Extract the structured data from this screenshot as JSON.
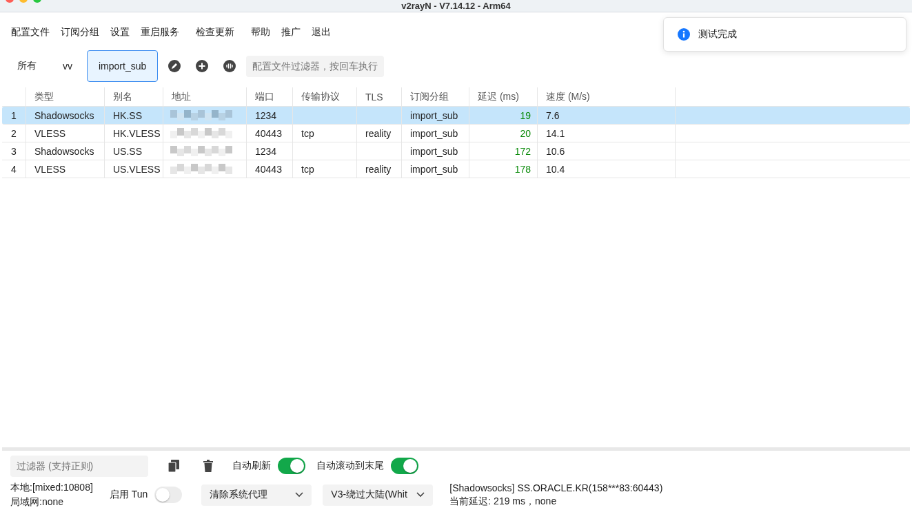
{
  "window": {
    "title": "v2rayN - V7.14.12 - Arm64"
  },
  "menu": [
    "配置文件",
    "订阅分组",
    "设置",
    "重启服务",
    "检查更新",
    "帮助",
    "推广",
    "退出"
  ],
  "tabs": [
    {
      "label": "所有",
      "selected": false
    },
    {
      "label": "vv",
      "selected": false
    },
    {
      "label": "import_sub",
      "selected": true
    }
  ],
  "profile_filter": {
    "placeholder": "配置文件过滤器，按回车执行"
  },
  "table": {
    "columns": [
      "类型",
      "别名",
      "地址",
      "端口",
      "传输协议",
      "TLS",
      "订阅分组",
      "延迟 (ms)",
      "速度 (M/s)"
    ],
    "rows": [
      {
        "index": "1",
        "type": "Shadowsocks",
        "alias": "HK.SS",
        "port": "1234",
        "transport": "",
        "tls": "",
        "group": "import_sub",
        "latency": "19",
        "speed": "7.6",
        "selected": true
      },
      {
        "index": "2",
        "type": "VLESS",
        "alias": "HK.VLESS",
        "port": "40443",
        "transport": "tcp",
        "tls": "reality",
        "group": "import_sub",
        "latency": "20",
        "speed": "14.1",
        "selected": false
      },
      {
        "index": "3",
        "type": "Shadowsocks",
        "alias": "US.SS",
        "port": "1234",
        "transport": "",
        "tls": "",
        "group": "import_sub",
        "latency": "172",
        "speed": "10.6",
        "selected": false
      },
      {
        "index": "4",
        "type": "VLESS",
        "alias": "US.VLESS",
        "port": "40443",
        "transport": "tcp",
        "tls": "reality",
        "group": "import_sub",
        "latency": "178",
        "speed": "10.4",
        "selected": false
      }
    ]
  },
  "log_filter": {
    "placeholder": "过滤器 (支持正则)"
  },
  "log_toggles": [
    {
      "label": "自动刷新",
      "on": true
    },
    {
      "label": "自动滚动到末尾",
      "on": true
    }
  ],
  "status": {
    "local": "本地:[mixed:10808]",
    "lan": "局域网:none",
    "tun": {
      "label": "启用 Tun",
      "on": false
    },
    "proxy_mode": "清除系统代理",
    "routing": "V3-绕过大陆(Whit",
    "server": "[Shadowsocks] SS.ORACLE.KR(158***83:60443)",
    "delay": "当前延迟: 219 ms，none"
  },
  "toast": {
    "message": "测试完成"
  }
}
